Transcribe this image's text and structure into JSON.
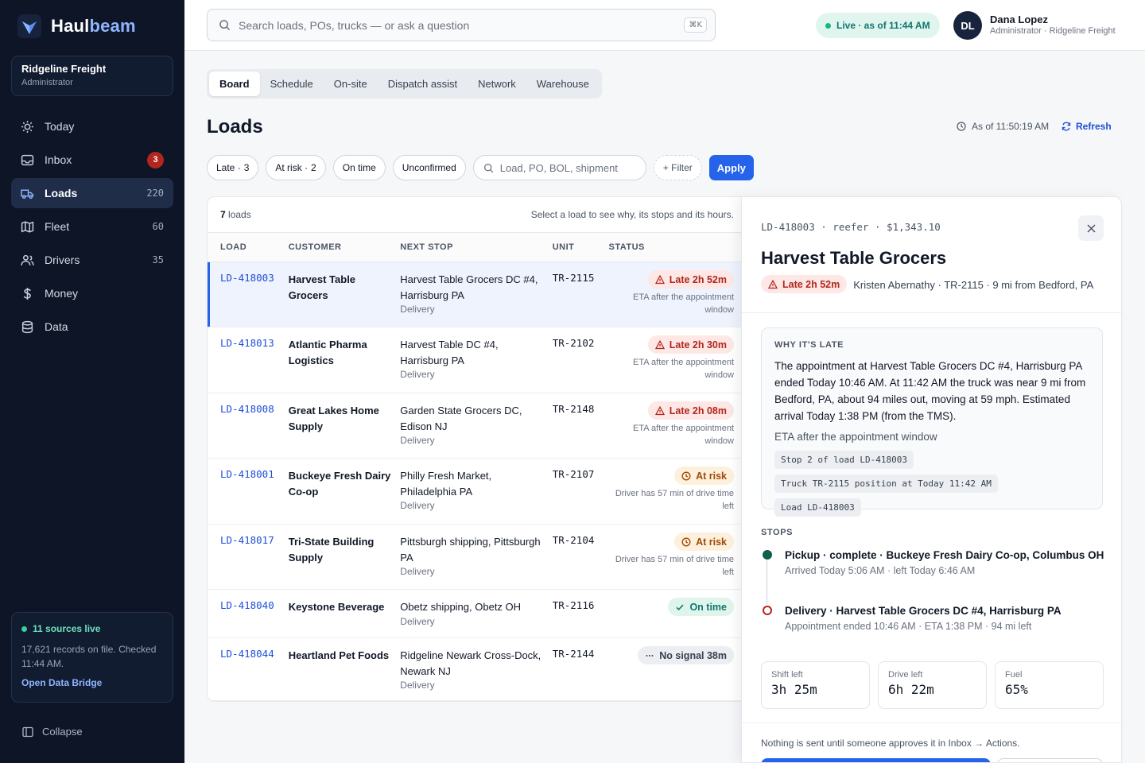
{
  "brand": {
    "name_a": "Haul",
    "name_b": "beam"
  },
  "org": {
    "name": "Ridgeline Freight",
    "role": "Administrator"
  },
  "nav": [
    {
      "label": "Today",
      "icon": "sun-icon"
    },
    {
      "label": "Inbox",
      "icon": "inbox-icon",
      "badge": "3"
    },
    {
      "label": "Loads",
      "icon": "truck-icon",
      "count": "220",
      "active": true
    },
    {
      "label": "Fleet",
      "icon": "map-icon",
      "count": "60"
    },
    {
      "label": "Drivers",
      "icon": "users-icon",
      "count": "35"
    },
    {
      "label": "Money",
      "icon": "dollar-icon"
    },
    {
      "label": "Data",
      "icon": "database-icon"
    }
  ],
  "sources": {
    "title": "11 sources live",
    "text": "17,621 records on file. Checked 11:44 AM.",
    "link": "Open Data Bridge"
  },
  "collapse_label": "Collapse",
  "search": {
    "placeholder": "Search loads, POs, trucks — or ask a question",
    "shortcut": "⌘K"
  },
  "live": {
    "label": "Live · as of 11:44 AM"
  },
  "user": {
    "initials": "DL",
    "name": "Dana Lopez",
    "role": "Administrator · Ridgeline Freight"
  },
  "tabs": [
    "Board",
    "Schedule",
    "On-site",
    "Dispatch assist",
    "Network",
    "Warehouse"
  ],
  "page": {
    "title": "Loads",
    "asof": "As of 11:50:19 AM",
    "refresh": "Refresh"
  },
  "filters": {
    "chips": [
      {
        "label": "Late ·",
        "count": "3"
      },
      {
        "label": "At risk ·",
        "count": "2"
      },
      {
        "label": "On time",
        "count": ""
      },
      {
        "label": "Unconfirmed",
        "count": ""
      }
    ],
    "search_placeholder": "Load, PO, BOL, shipment",
    "add_filter": "+ Filter",
    "apply": "Apply"
  },
  "table": {
    "count": "7",
    "count_suffix": " loads",
    "hint": "Select a load to see why, its stops and its hours.",
    "headers": {
      "load": "LOAD",
      "customer": "CUSTOMER",
      "next_stop": "NEXT STOP",
      "unit": "UNIT",
      "status": "STATUS"
    },
    "rows": [
      {
        "id": "LD-418003",
        "customer": "Harvest Table Grocers",
        "stop": "Harvest Table Grocers DC #4, Harrisburg PA",
        "kind": "Delivery",
        "unit": "TR-2115",
        "status": "Late 2h 52m",
        "status_type": "late",
        "note": "ETA after the appointment window",
        "selected": true
      },
      {
        "id": "LD-418013",
        "customer": "Atlantic Pharma Logistics",
        "stop": "Harvest Table DC #4, Harrisburg PA",
        "kind": "Delivery",
        "unit": "TR-2102",
        "status": "Late 2h 30m",
        "status_type": "late",
        "note": "ETA after the appointment window"
      },
      {
        "id": "LD-418008",
        "customer": "Great Lakes Home Supply",
        "stop": "Garden State Grocers DC, Edison NJ",
        "kind": "Delivery",
        "unit": "TR-2148",
        "status": "Late 2h 08m",
        "status_type": "late",
        "note": "ETA after the appointment window"
      },
      {
        "id": "LD-418001",
        "customer": "Buckeye Fresh Dairy Co-op",
        "stop": "Philly Fresh Market, Philadelphia PA",
        "kind": "Delivery",
        "unit": "TR-2107",
        "status": "At risk",
        "status_type": "risk",
        "note": "Driver has 57 min of drive time left"
      },
      {
        "id": "LD-418017",
        "customer": "Tri-State Building Supply",
        "stop": "Pittsburgh shipping, Pittsburgh PA",
        "kind": "Delivery",
        "unit": "TR-2104",
        "status": "At risk",
        "status_type": "risk",
        "note": "Driver has 57 min of drive time left"
      },
      {
        "id": "LD-418040",
        "customer": "Keystone Beverage",
        "stop": "Obetz shipping, Obetz OH",
        "kind": "Delivery",
        "unit": "TR-2116",
        "status": "On time",
        "status_type": "ontime",
        "note": ""
      },
      {
        "id": "LD-418044",
        "customer": "Heartland Pet Foods",
        "stop": "Ridgeline Newark Cross-Dock, Newark NJ",
        "kind": "Delivery",
        "unit": "TR-2144",
        "status": "No signal 38m",
        "status_type": "nosig",
        "note": ""
      }
    ]
  },
  "detail": {
    "meta": "LD-418003 · reefer · $1,343.10",
    "title": "Harvest Table Grocers",
    "status": "Late 2h 52m",
    "sub": "Kristen Abernathy · TR-2115 · 9 mi from Bedford, PA",
    "why_label": "WHY IT'S LATE",
    "why_text": "The appointment at Harvest Table Grocers DC #4, Harrisburg PA ended Today 10:46 AM. At 11:42 AM the truck was near 9 mi from Bedford, PA, about 94 miles out, moving at 59 mph. Estimated arrival Today 1:38 PM (from the TMS).",
    "why_eta": "ETA after the appointment window",
    "refs": [
      "Stop 2 of load LD-418003",
      "Truck TR-2115 position at Today 11:42 AM",
      "Load LD-418003"
    ],
    "stops_label": "STOPS",
    "stops": [
      {
        "title": "Pickup · complete · Buckeye Fresh Dairy Co-op, Columbus OH",
        "sub": "Arrived Today 5:06 AM · left Today 6:46 AM"
      },
      {
        "title": "Delivery · Harvest Table Grocers DC #4, Harrisburg PA",
        "sub": "Appointment ended 10:46 AM · ETA 1:38 PM · 94 mi left"
      }
    ],
    "metrics": [
      {
        "label": "Shift left",
        "value": "3h 25m"
      },
      {
        "label": "Drive left",
        "value": "6h 22m"
      },
      {
        "label": "Fuel",
        "value": "65%"
      }
    ],
    "footer": "Nothing is sent until someone approves it in Inbox → Actions."
  },
  "colors": {
    "accent": "#2563eb",
    "late": "#b3261e",
    "risk": "#a14a07",
    "ontime": "#0f766e",
    "sidebar": "#0d1526"
  }
}
